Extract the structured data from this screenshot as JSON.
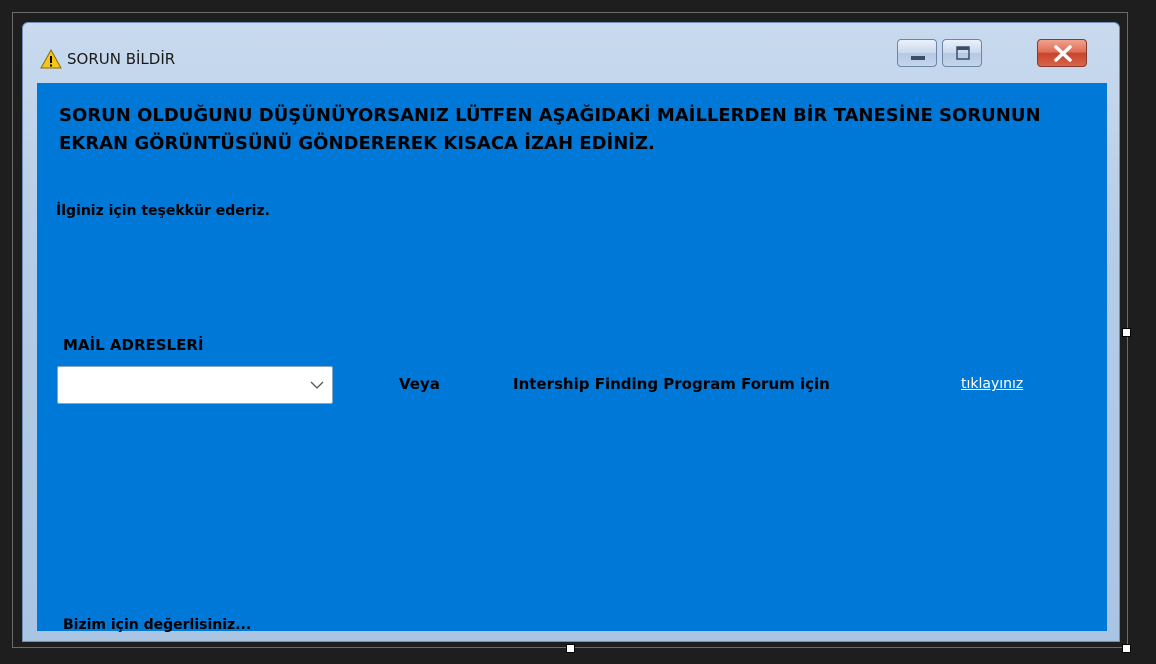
{
  "window": {
    "title": "SORUN BİLDİR",
    "title_icon": "warning-icon",
    "controls": [
      "minimize-icon",
      "maximize-icon",
      "close-icon"
    ]
  },
  "content": {
    "heading": "SORUN OLDUĞUNU DÜŞÜNÜYORSANIZ LÜTFEN AŞAĞIDAKİ MAİLLERDEN BİR TANESİNE SORUNUN EKRAN GÖRÜNTÜSÜNÜ GÖNDEREREK KISACA İZAH EDİNİZ.",
    "thanks": "İlginiz için teşekkür ederiz.",
    "mail_label": "MAİL ADRESLERİ",
    "mail_select": {
      "value": ""
    },
    "or_label": "Veya",
    "forum_label": "Intership Finding Program Forum için",
    "forum_link": "tıklayınız",
    "footer": "Bizim için değerlisiniz..."
  },
  "colors": {
    "client_background": "#0078d7",
    "link": "#ffffff",
    "close_button": "#d6654c"
  }
}
